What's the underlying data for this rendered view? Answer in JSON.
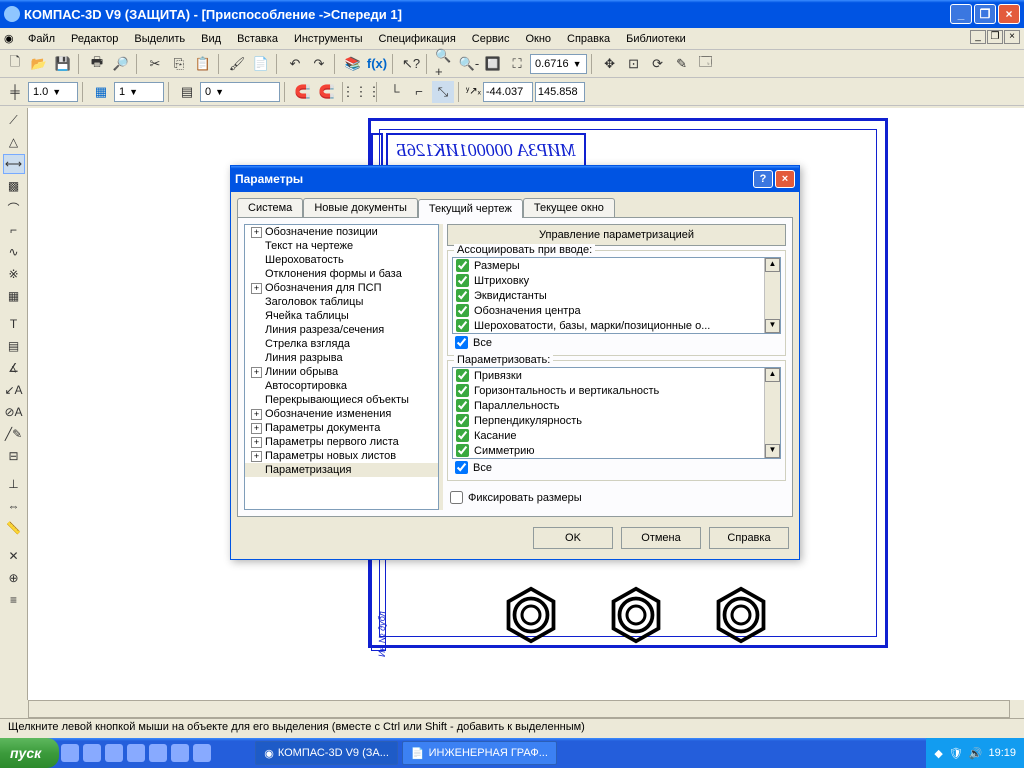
{
  "window": {
    "title": "КОМПАС-3D V9 (ЗАЩИТА) - [Приспособление ->Спереди 1]"
  },
  "menu": [
    "Файл",
    "Редактор",
    "Выделить",
    "Вид",
    "Вставка",
    "Инструменты",
    "Спецификация",
    "Сервис",
    "Окно",
    "Справка",
    "Библиотеки"
  ],
  "toolbar2": {
    "zoom": "0.6716"
  },
  "toolbar3": {
    "v1": "1.0",
    "v2": "1",
    "v3": "0",
    "cx": "-44.037",
    "cy": "145.858"
  },
  "drawing_label": "МИРЗА 000001ИК126Б",
  "status": "Щелкните левой кнопкой мыши на объекте для его выделения (вместе с Ctrl или Shift - добавить к выделенным)",
  "taskbar": {
    "start": "пуск",
    "task1": "КОМПАС-3D V9 (ЗА...",
    "task2": "ИНЖЕНЕРНАЯ ГРАФ...",
    "time": "19:19"
  },
  "dialog": {
    "title": "Параметры",
    "tabs": [
      "Система",
      "Новые документы",
      "Текущий чертеж",
      "Текущее окно"
    ],
    "tree": [
      {
        "t": "Обозначение позиции",
        "e": 1
      },
      {
        "t": "Текст на чертеже"
      },
      {
        "t": "Шероховатость"
      },
      {
        "t": "Отклонения формы и база"
      },
      {
        "t": "Обозначения для ПСП",
        "e": 1
      },
      {
        "t": "Заголовок таблицы"
      },
      {
        "t": "Ячейка таблицы"
      },
      {
        "t": "Линия разреза/сечения"
      },
      {
        "t": "Стрелка взгляда"
      },
      {
        "t": "Линия разрыва"
      },
      {
        "t": "Линии обрыва",
        "e": 1
      },
      {
        "t": "Автосортировка"
      },
      {
        "t": "Перекрывающиеся объекты"
      },
      {
        "t": "Обозначение изменения",
        "e": 1
      },
      {
        "t": "Параметры документа",
        "e": 1
      },
      {
        "t": "Параметры первого листа",
        "e": 1
      },
      {
        "t": "Параметры новых листов",
        "e": 1
      },
      {
        "t": "Параметризация",
        "sel": 1
      }
    ],
    "right_button": "Управление параметризацией",
    "group1": {
      "label": "Ассоциировать при вводе:",
      "items": [
        "Размеры",
        "Штриховку",
        "Эквидистанты",
        "Обозначения центра",
        "Шероховатости, базы, марки/позиционные о..."
      ],
      "all": "Все"
    },
    "group2": {
      "label": "Параметризовать:",
      "items": [
        "Привязки",
        "Горизонтальность и вертикальность",
        "Параллельность",
        "Перпендикулярность",
        "Касание",
        "Симметрию"
      ],
      "all": "Все"
    },
    "fix": "Фиксировать размеры",
    "buttons": [
      "OK",
      "Отмена",
      "Справка"
    ]
  }
}
